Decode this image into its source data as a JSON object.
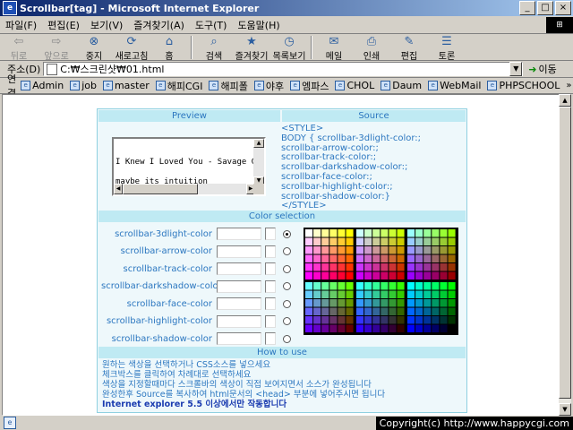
{
  "window": {
    "title": "Scrollbar[tag] - Microsoft Internet Explorer",
    "buttons": {
      "minimize": "_",
      "maximize": "□",
      "close": "×"
    }
  },
  "menu": [
    "파일(F)",
    "편집(E)",
    "보기(V)",
    "즐겨찾기(A)",
    "도구(T)",
    "도움말(H)"
  ],
  "toolbar": {
    "back": "뒤로",
    "forward": "앞으로",
    "stop": "중지",
    "refresh": "새로고침",
    "home": "홈",
    "search": "검색",
    "favorites": "즐겨찾기",
    "history": "목록보기",
    "mail": "메일",
    "print": "인쇄",
    "edit": "편집",
    "discuss": "토론"
  },
  "address": {
    "label": "주소(D)",
    "value": "C:₩스크린샷₩01.html",
    "go": "이동"
  },
  "links": {
    "label": "연결",
    "items": [
      "Admin",
      "job",
      "master",
      "해피CGI",
      "해피폴",
      "야후",
      "엠파스",
      "CHOL",
      "Daum",
      "WebMail",
      "PHPSCHOOL"
    ],
    "more": "»"
  },
  "page": {
    "headers": {
      "preview": "Preview",
      "source": "Source",
      "color_selection": "Color selection",
      "how_to_use": "How to use"
    },
    "source_lines": [
      "<STYLE>",
      "BODY { scrollbar-3dlight-color:;",
      "scrollbar-arrow-color:;",
      "scrollbar-track-color:;",
      "scrollbar-darkshadow-color:;",
      "scrollbar-face-color:;",
      "scrollbar-highlight-color:;",
      "scrollbar-shadow-color:}",
      "</STYLE>"
    ],
    "preview_text": "\nI Knew I Loved You - Savage Garden\n\nmaybe its intuition\nbut some things you just don't questio",
    "properties": [
      {
        "label": "scrollbar-3dlight-color",
        "selected": true
      },
      {
        "label": "scrollbar-arrow-color",
        "selected": false
      },
      {
        "label": "scrollbar-track-color",
        "selected": false
      },
      {
        "label": "scrollbar-darkshadow-color",
        "selected": false
      },
      {
        "label": "scrollbar-face-color",
        "selected": false
      },
      {
        "label": "scrollbar-highlight-color",
        "selected": false
      },
      {
        "label": "scrollbar-shadow-color",
        "selected": false
      }
    ],
    "instructions": [
      "원하는 색상을 선택하거나 CSS소스를 넣으세요",
      "체크박스를 클릭하여 차례대로 선택하세요",
      "색상을 지정할때마다 스크롤바의 색상이 직접 보여지면서 소스가 완성됩니다",
      "완성한후 Source를 복사하여 html문서의 <head> 부분에 넣어주시면 됩니다"
    ],
    "note": "Internet explorer 5.5 이상에서만 작동합니다"
  },
  "status": {
    "copyright": "Copyright(c) http://www.happycgi.com"
  }
}
